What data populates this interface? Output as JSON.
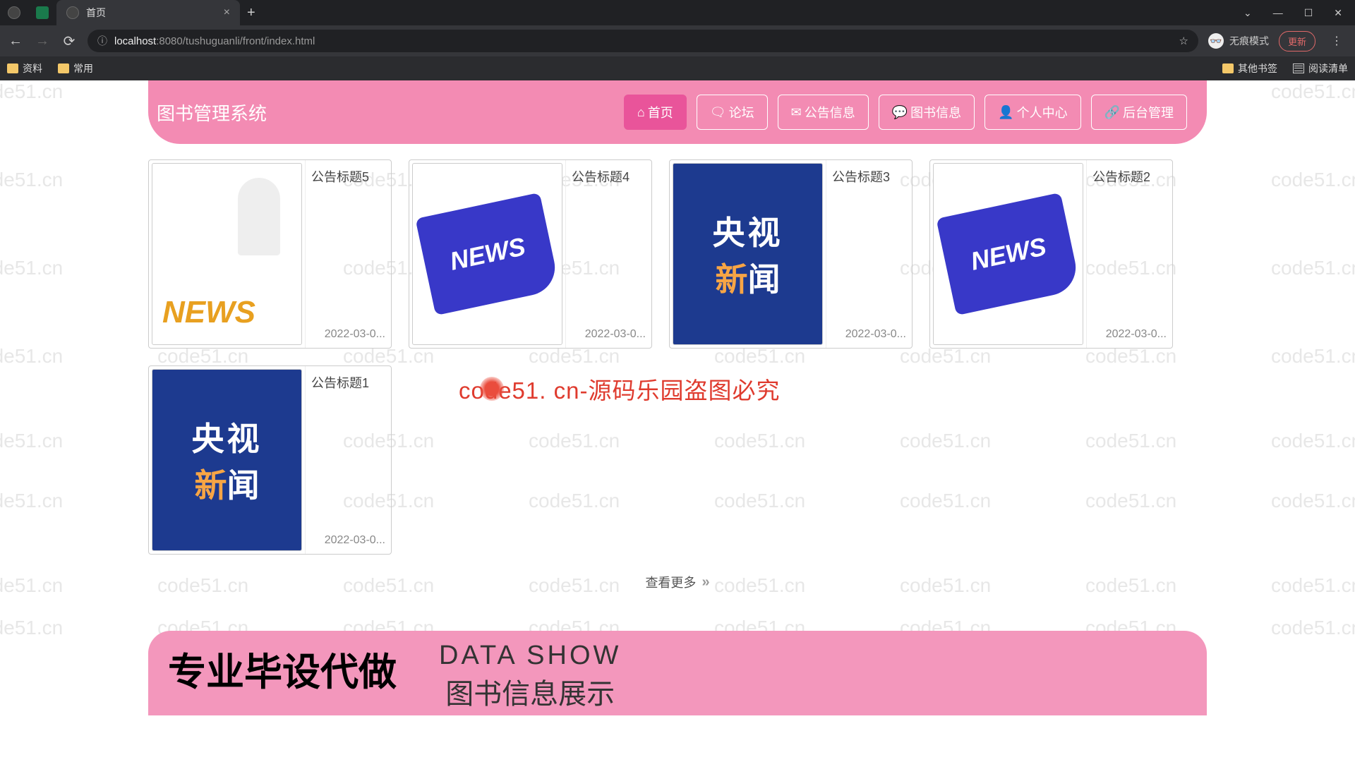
{
  "browser": {
    "tab_title": "首页",
    "new_tab": "+",
    "url_host": "localhost",
    "url_port": ":8080",
    "url_path": "/tushuguanli/front/index.html",
    "incognito": "无痕模式",
    "update": "更新",
    "bookmarks": {
      "item1": "资料",
      "item2": "常用",
      "other": "其他书签",
      "reading": "阅读清单"
    },
    "win": {
      "min": "—",
      "max": "☐",
      "close": "✕",
      "down": "⌄"
    }
  },
  "header": {
    "logo": "图书管理系统",
    "nav": [
      {
        "icon": "⌂",
        "label": "首页",
        "active": true
      },
      {
        "icon": "🗨",
        "label": "论坛",
        "active": false
      },
      {
        "icon": "✉",
        "label": "公告信息",
        "active": false
      },
      {
        "icon": "💬",
        "label": "图书信息",
        "active": false
      },
      {
        "icon": "👤",
        "label": "个人中心",
        "active": false
      },
      {
        "icon": "🔗",
        "label": "后台管理",
        "active": false
      }
    ]
  },
  "cards": [
    {
      "title": "公告标题5",
      "date": "2022-03-0...",
      "thumb": "3d"
    },
    {
      "title": "公告标题4",
      "date": "2022-03-0...",
      "thumb": "news"
    },
    {
      "title": "公告标题3",
      "date": "2022-03-0...",
      "thumb": "cctv"
    },
    {
      "title": "公告标题2",
      "date": "2022-03-0...",
      "thumb": "news"
    },
    {
      "title": "公告标题1",
      "date": "2022-03-0...",
      "thumb": "cctv"
    }
  ],
  "see_more": "查看更多",
  "bottom": {
    "left": "专业毕设代做",
    "en": "DATA SHOW",
    "zh": "图书信息展示"
  },
  "overlay": "code51. cn-源码乐园盗图必究",
  "watermark": "code51.cn"
}
